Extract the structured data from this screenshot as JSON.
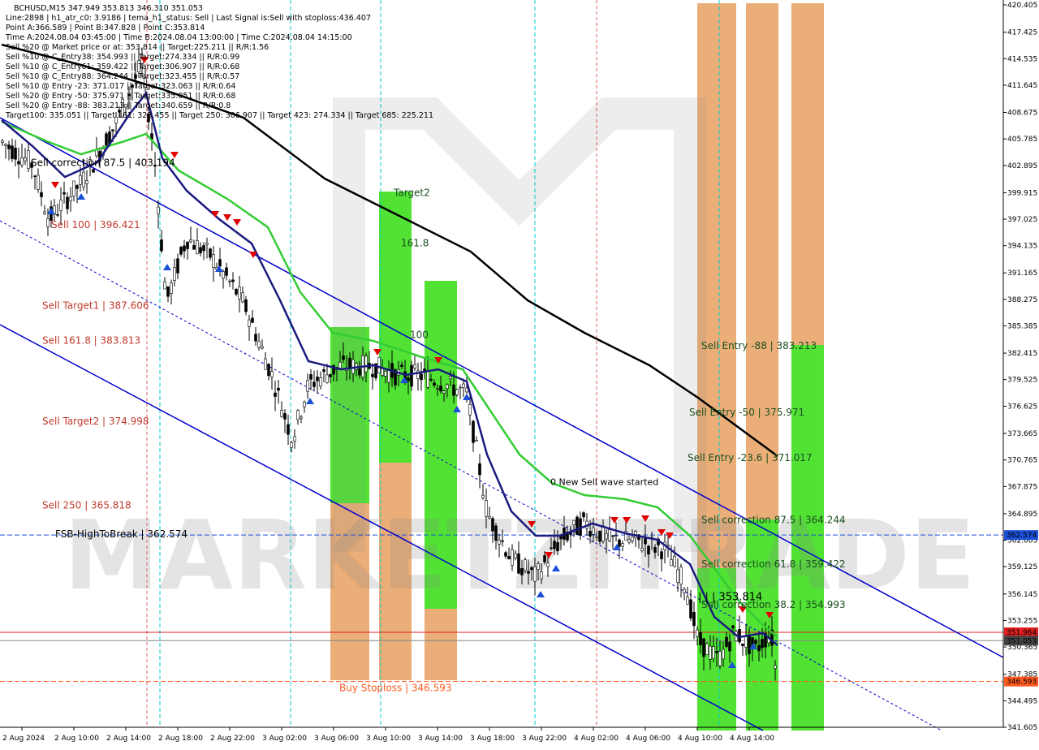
{
  "symbol": "BCHUSD",
  "timeframe": "M15",
  "chart_data": {
    "type": "candlestick",
    "title": "BCHUSD,M15",
    "ylim": [
      341.605,
      420.405
    ],
    "info_lines": [
      "BCHUSD,M15  347.949 353.813 346.310 351.053",
      "Line:2898  |  h1_atr_c0: 3.9186  |  tema_h1_status: Sell  |  Last Signal is:Sell with stoploss:436.407",
      "Point A:366.589  |  Point B:347.828  |  Point C:353.814",
      "Time A:2024.08.04 03:45:00  |  Time B:2024.08.04 13:00:00  |  Time C:2024.08.04 14:15:00",
      "Sell %20 @ Market price or at: 353.814  ||  Target:225.211  ||  R/R:1.56",
      "Sell %10 @ C_Entry38: 354.993  ||  Target:274.334  ||  R/R:0.99",
      "Sell %10 @ C_Entry61: 359.422  ||  Target:306.907  ||  R/R:0.68",
      "Sell %10 @ C_Entry88: 364.244  ||  Target:323.455  ||  R/R:0.57",
      "Sell %10 @ Entry -23: 371.017  ||  Target:323.063  ||  R/R:0.64",
      "Sell %20 @ Entry -50: 375.971  ||  Target:335.051  ||  R/R:0.68",
      "Sell %20 @ Entry -88: 383.213  ||  Target:340.659  ||  R/R:0.8",
      "Target100: 335.051  ||  Target 161: 323.455  ||  Target 250: 306.907  ||  Target 423: 274.334  ||  Target 685: 225.211"
    ],
    "y_ticks": [
      "420.405",
      "417.425",
      "414.535",
      "411.645",
      "408.675",
      "405.785",
      "402.895",
      "399.915",
      "397.025",
      "394.135",
      "391.165",
      "388.275",
      "385.385",
      "382.415",
      "379.525",
      "376.625",
      "373.665",
      "370.765",
      "367.875",
      "364.895",
      "362.005",
      "359.125",
      "356.145",
      "353.255",
      "350.365",
      "347.385",
      "344.495",
      "341.605"
    ],
    "x_ticks": [
      "2 Aug 2024",
      "2 Aug 10:00",
      "2 Aug 14:00",
      "2 Aug 18:00",
      "2 Aug 22:00",
      "3 Aug 02:00",
      "3 Aug 06:00",
      "3 Aug 10:00",
      "3 Aug 14:00",
      "3 Aug 18:00",
      "3 Aug 22:00",
      "4 Aug 02:00",
      "4 Aug 06:00",
      "4 Aug 10:00",
      "4 Aug 14:00"
    ],
    "price_badges": [
      {
        "value": "362.574",
        "color": "#1a4fd6"
      },
      {
        "value": "351.964",
        "color": "#e02020"
      },
      {
        "value": "351.053",
        "color": "#444444"
      },
      {
        "value": "346.593",
        "color": "#ff5a1f"
      }
    ],
    "horizontal_levels": [
      {
        "label": "FSB-HighToBreak | 362.574",
        "price": 362.574,
        "color": "#1a4fd6",
        "style": "dashed"
      },
      {
        "label": "Buy Stoploss | 346.593",
        "price": 346.593,
        "color": "#ff5a1f",
        "style": "dashed"
      },
      {
        "price": 351.964,
        "color": "#e02020",
        "style": "solid"
      },
      {
        "price": 351.053,
        "color": "#888888",
        "style": "solid"
      }
    ],
    "left_annotations": [
      {
        "text": "Sell correction 87.5 | 403.194",
        "price": 403.194,
        "color": "#000000"
      },
      {
        "text": "Sell 100 | 396.421",
        "price": 396.421,
        "color": "#c0392b"
      },
      {
        "text": "Sell Target1 | 387.606",
        "price": 387.606,
        "color": "#c0392b"
      },
      {
        "text": "Sell 161.8 | 383.813",
        "price": 383.813,
        "color": "#c0392b"
      },
      {
        "text": "Sell Target2 | 374.998",
        "price": 374.998,
        "color": "#c0392b"
      },
      {
        "text": "Sell  250 | 365.818",
        "price": 365.818,
        "color": "#c0392b"
      }
    ],
    "right_annotations": [
      {
        "text": "Sell Entry -88 | 383.213",
        "price": 383.213
      },
      {
        "text": "Sell Entry -50 | 375.971",
        "price": 375.971
      },
      {
        "text": "Sell Entry -23.6 | 371.017",
        "price": 371.017
      },
      {
        "text": "Sell correction 87.5 | 364.244",
        "price": 364.244
      },
      {
        "text": "Sell correction 61.8 | 359.422",
        "price": 359.422
      },
      {
        "text": "Sell correction 38.2 | 354.993",
        "price": 354.993
      }
    ],
    "other_annotations": [
      {
        "text": "Target2",
        "price": 399.9
      },
      {
        "text": "161.8",
        "price": 394.4
      },
      {
        "text": "100",
        "price": 384.4
      },
      {
        "text": "0 New Sell wave started",
        "price": 368.4
      },
      {
        "text": "| | | 353.814",
        "price": 355.8
      }
    ],
    "watermark": "MARKETZITRADE",
    "colors": {
      "channel": "#0000cc",
      "ma_fast": "#1a1a80",
      "ma_mid": "#33cc33",
      "ma_slow": "#000000",
      "vline": "#00cccc",
      "bull_zone": "#33dd11",
      "bear_zone": "#e8a060"
    }
  }
}
